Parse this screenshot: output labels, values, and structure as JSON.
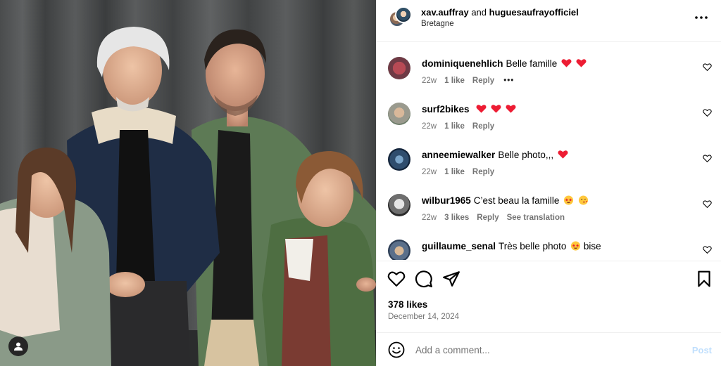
{
  "header": {
    "user1": "xav.auffray",
    "joiner": "and",
    "user2": "huguesaufrayofficiel",
    "location": "Bretagne",
    "more_icon": "more-horizontal-icon"
  },
  "comments": [
    {
      "user": "dominiquenehlich",
      "text": "Belle famille",
      "emojis": [
        "red-heart",
        "red-heart"
      ],
      "time": "22w",
      "likes": "1 like",
      "reply": "Reply",
      "extra": "more-options",
      "translation": ""
    },
    {
      "user": "surf2bikes",
      "text": "",
      "emojis": [
        "red-heart",
        "red-heart",
        "red-heart"
      ],
      "time": "22w",
      "likes": "1 like",
      "reply": "Reply",
      "extra": "",
      "translation": ""
    },
    {
      "user": "anneemiewalker",
      "text": "Belle photo,,,",
      "emojis": [
        "red-heart"
      ],
      "time": "22w",
      "likes": "1 like",
      "reply": "Reply",
      "extra": "",
      "translation": ""
    },
    {
      "user": "wilbur1965",
      "text": "C’est beau la famille",
      "emojis": [
        "star-struck",
        "kissing-face"
      ],
      "time": "22w",
      "likes": "3 likes",
      "reply": "Reply",
      "extra": "",
      "translation": "See translation"
    },
    {
      "user": "guillaume_senal",
      "text": "Très belle photo",
      "emojis": [
        "star-struck"
      ],
      "text_after": "bise",
      "time": "",
      "likes": "",
      "reply": "",
      "extra": "",
      "translation": ""
    }
  ],
  "actions": {
    "like_icon": "heart-icon",
    "comment_icon": "comment-icon",
    "share_icon": "share-icon",
    "save_icon": "bookmark-icon"
  },
  "likes_count": "378 likes",
  "post_date": "December 14, 2024",
  "add_comment": {
    "placeholder": "Add a comment...",
    "post_label": "Post"
  },
  "photo": {
    "tag_icon": "user-tag-icon"
  },
  "colors": {
    "heart": "#ed1c33",
    "secondary_text": "#737373",
    "post_button_disabled": "#c0dffd",
    "divider": "#efefef"
  }
}
